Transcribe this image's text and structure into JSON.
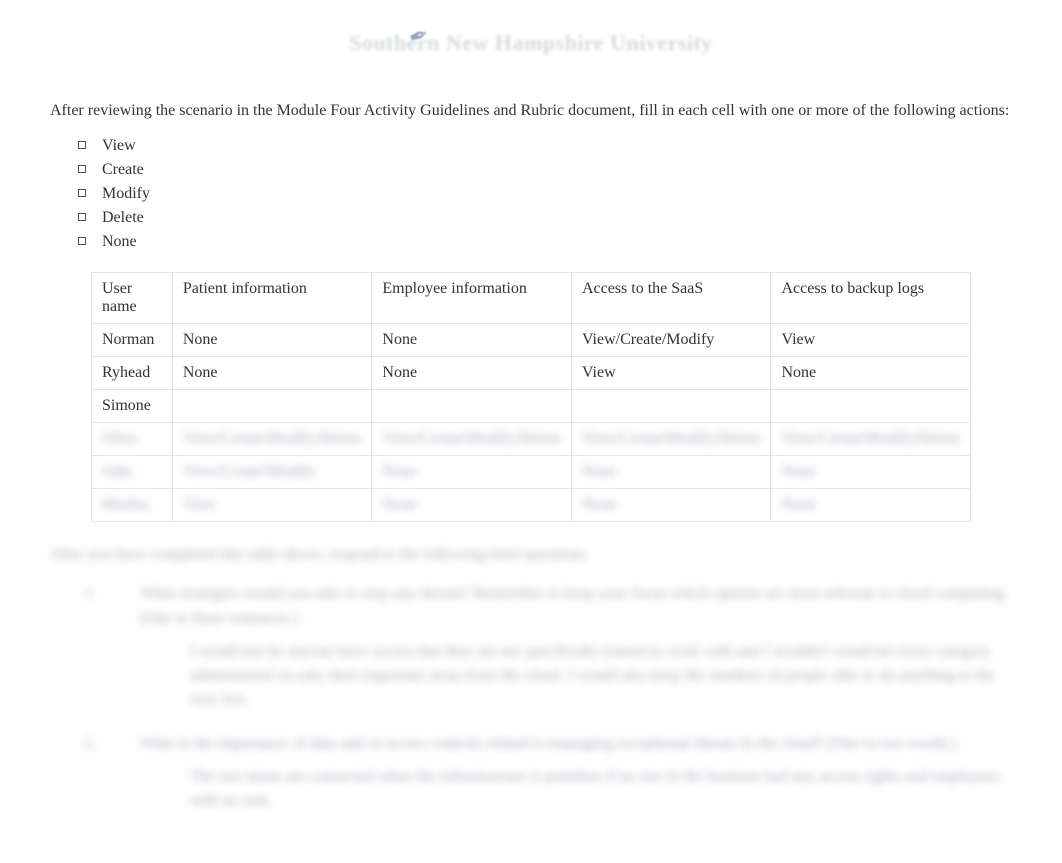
{
  "header": {
    "org": "Southern New Hampshire University"
  },
  "intro": "After reviewing the scenario in the Module Four Activity Guidelines and Rubric document, fill in each cell with one or more of the following actions:",
  "actions": [
    "View",
    "Create",
    "Modify",
    "Delete",
    "None"
  ],
  "table": {
    "headers": [
      "User name",
      "Patient information",
      "Employee information",
      "Access to the SaaS",
      "Access to backup logs"
    ],
    "rows": [
      {
        "cells": [
          "Norman",
          "None",
          "None",
          "View/Create/Modify",
          "View"
        ],
        "blurred": false
      },
      {
        "cells": [
          "Ryhead",
          "None",
          "None",
          "View",
          "None"
        ],
        "blurred": false
      },
      {
        "cells": [
          "Simone",
          "",
          "",
          "",
          ""
        ],
        "blurred": false
      },
      {
        "cells": [
          "Olive",
          "View/Create/Modify/Delete",
          "View/Create/Modify/Delete",
          "View/Create/Modify/Delete",
          "View/Create/Modify/Delete"
        ],
        "blurred": true
      },
      {
        "cells": [
          "John",
          "View/Create/Modify",
          "None",
          "None",
          "None"
        ],
        "blurred": true
      },
      {
        "cells": [
          "Martha",
          "View",
          "None",
          "None",
          "None"
        ],
        "blurred": true
      }
    ]
  },
  "followup_intro": "After you have completed this table above, respond to the following brief questions:",
  "questions": [
    {
      "q": "What strategies would you take to stop any threats? Remember to keep your focus which options are most relevant to cloud computing. (One to three sentences.)",
      "a": "I would not let anyone have access that they are not specifically trained to work with and I wouldn't would let every category administered on only their important areas from the cloud. I would also keep the numbers of people able to do anything to the very few."
    },
    {
      "q": "What is the importance of data and or access controls related to managing exceptional threats in the cloud? (One to two words.)",
      "a": "The two items are connected when the infrastructure is pointless if no one in the business had any access rights and employees with no task."
    }
  ]
}
